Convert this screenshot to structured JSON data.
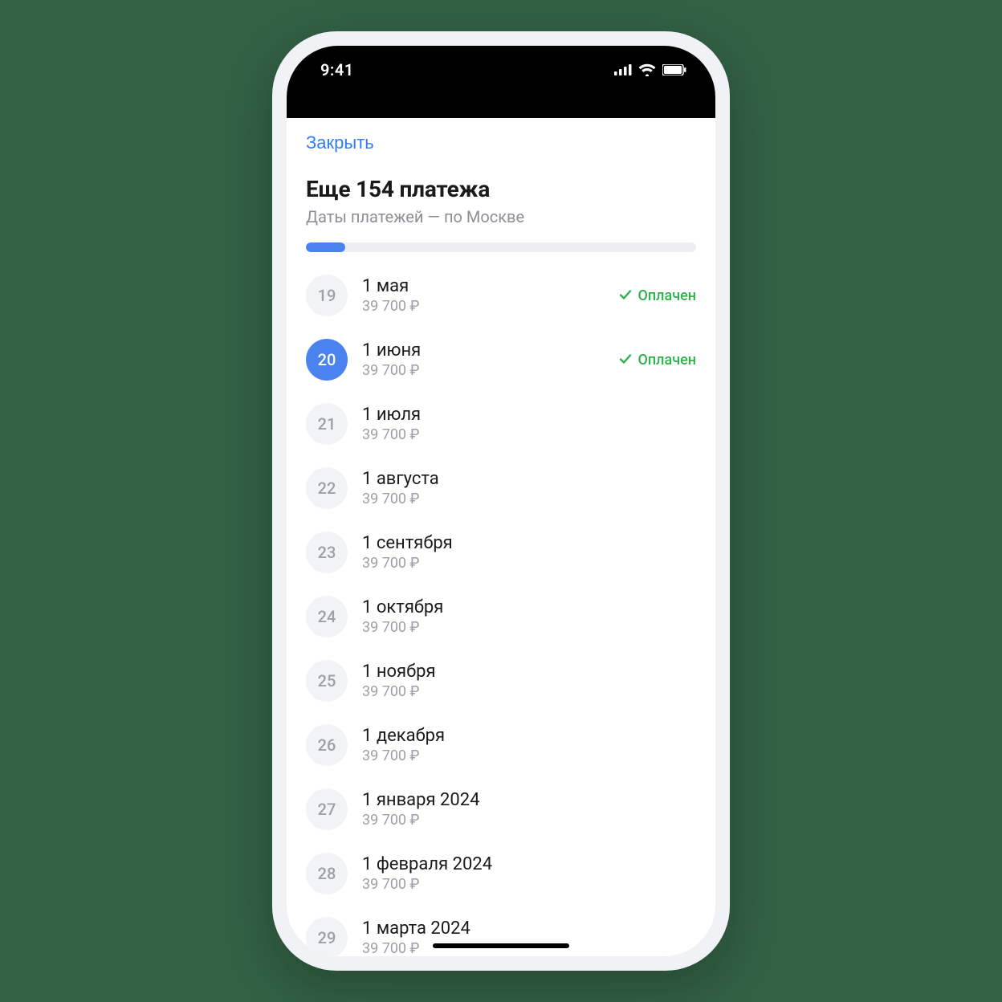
{
  "statusbar": {
    "time": "9:41"
  },
  "header": {
    "close_label": "Закрыть",
    "title": "Еще 154 платежа",
    "subtitle": "Даты платежей — по Москве"
  },
  "progress": {
    "percent": 10
  },
  "status_labels": {
    "paid": "Оплачен"
  },
  "payments": [
    {
      "num": "19",
      "date": "1 мая",
      "amount": "39 700 ₽",
      "paid": true,
      "active": false
    },
    {
      "num": "20",
      "date": "1 июня",
      "amount": "39 700 ₽",
      "paid": true,
      "active": true
    },
    {
      "num": "21",
      "date": "1 июля",
      "amount": "39 700 ₽",
      "paid": false,
      "active": false
    },
    {
      "num": "22",
      "date": "1 августа",
      "amount": "39 700 ₽",
      "paid": false,
      "active": false
    },
    {
      "num": "23",
      "date": "1 сентября",
      "amount": "39 700 ₽",
      "paid": false,
      "active": false
    },
    {
      "num": "24",
      "date": "1 октября",
      "amount": "39 700 ₽",
      "paid": false,
      "active": false
    },
    {
      "num": "25",
      "date": "1 ноября",
      "amount": "39 700 ₽",
      "paid": false,
      "active": false
    },
    {
      "num": "26",
      "date": "1 декабря",
      "amount": "39 700 ₽",
      "paid": false,
      "active": false
    },
    {
      "num": "27",
      "date": "1 января 2024",
      "amount": "39 700 ₽",
      "paid": false,
      "active": false
    },
    {
      "num": "28",
      "date": "1 февраля 2024",
      "amount": "39 700 ₽",
      "paid": false,
      "active": false
    },
    {
      "num": "29",
      "date": "1 марта 2024",
      "amount": "39 700 ₽",
      "paid": false,
      "active": false
    }
  ]
}
